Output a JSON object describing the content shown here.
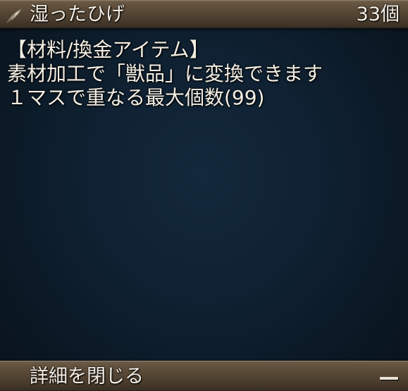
{
  "item": {
    "icon": "feather-icon",
    "name": "湿ったひげ",
    "count": "33個"
  },
  "description": {
    "lines": [
      "【材料/換金アイテム】",
      "素材加工で「獣品」に変換できます",
      "１マスで重なる最大個数(99)"
    ]
  },
  "footer": {
    "close_label": "詳細を閉じる",
    "collapse_icon": "minus-icon"
  },
  "colors": {
    "bar": "#5a4a37",
    "background": "#0f2132",
    "text": "#f3eee4"
  }
}
